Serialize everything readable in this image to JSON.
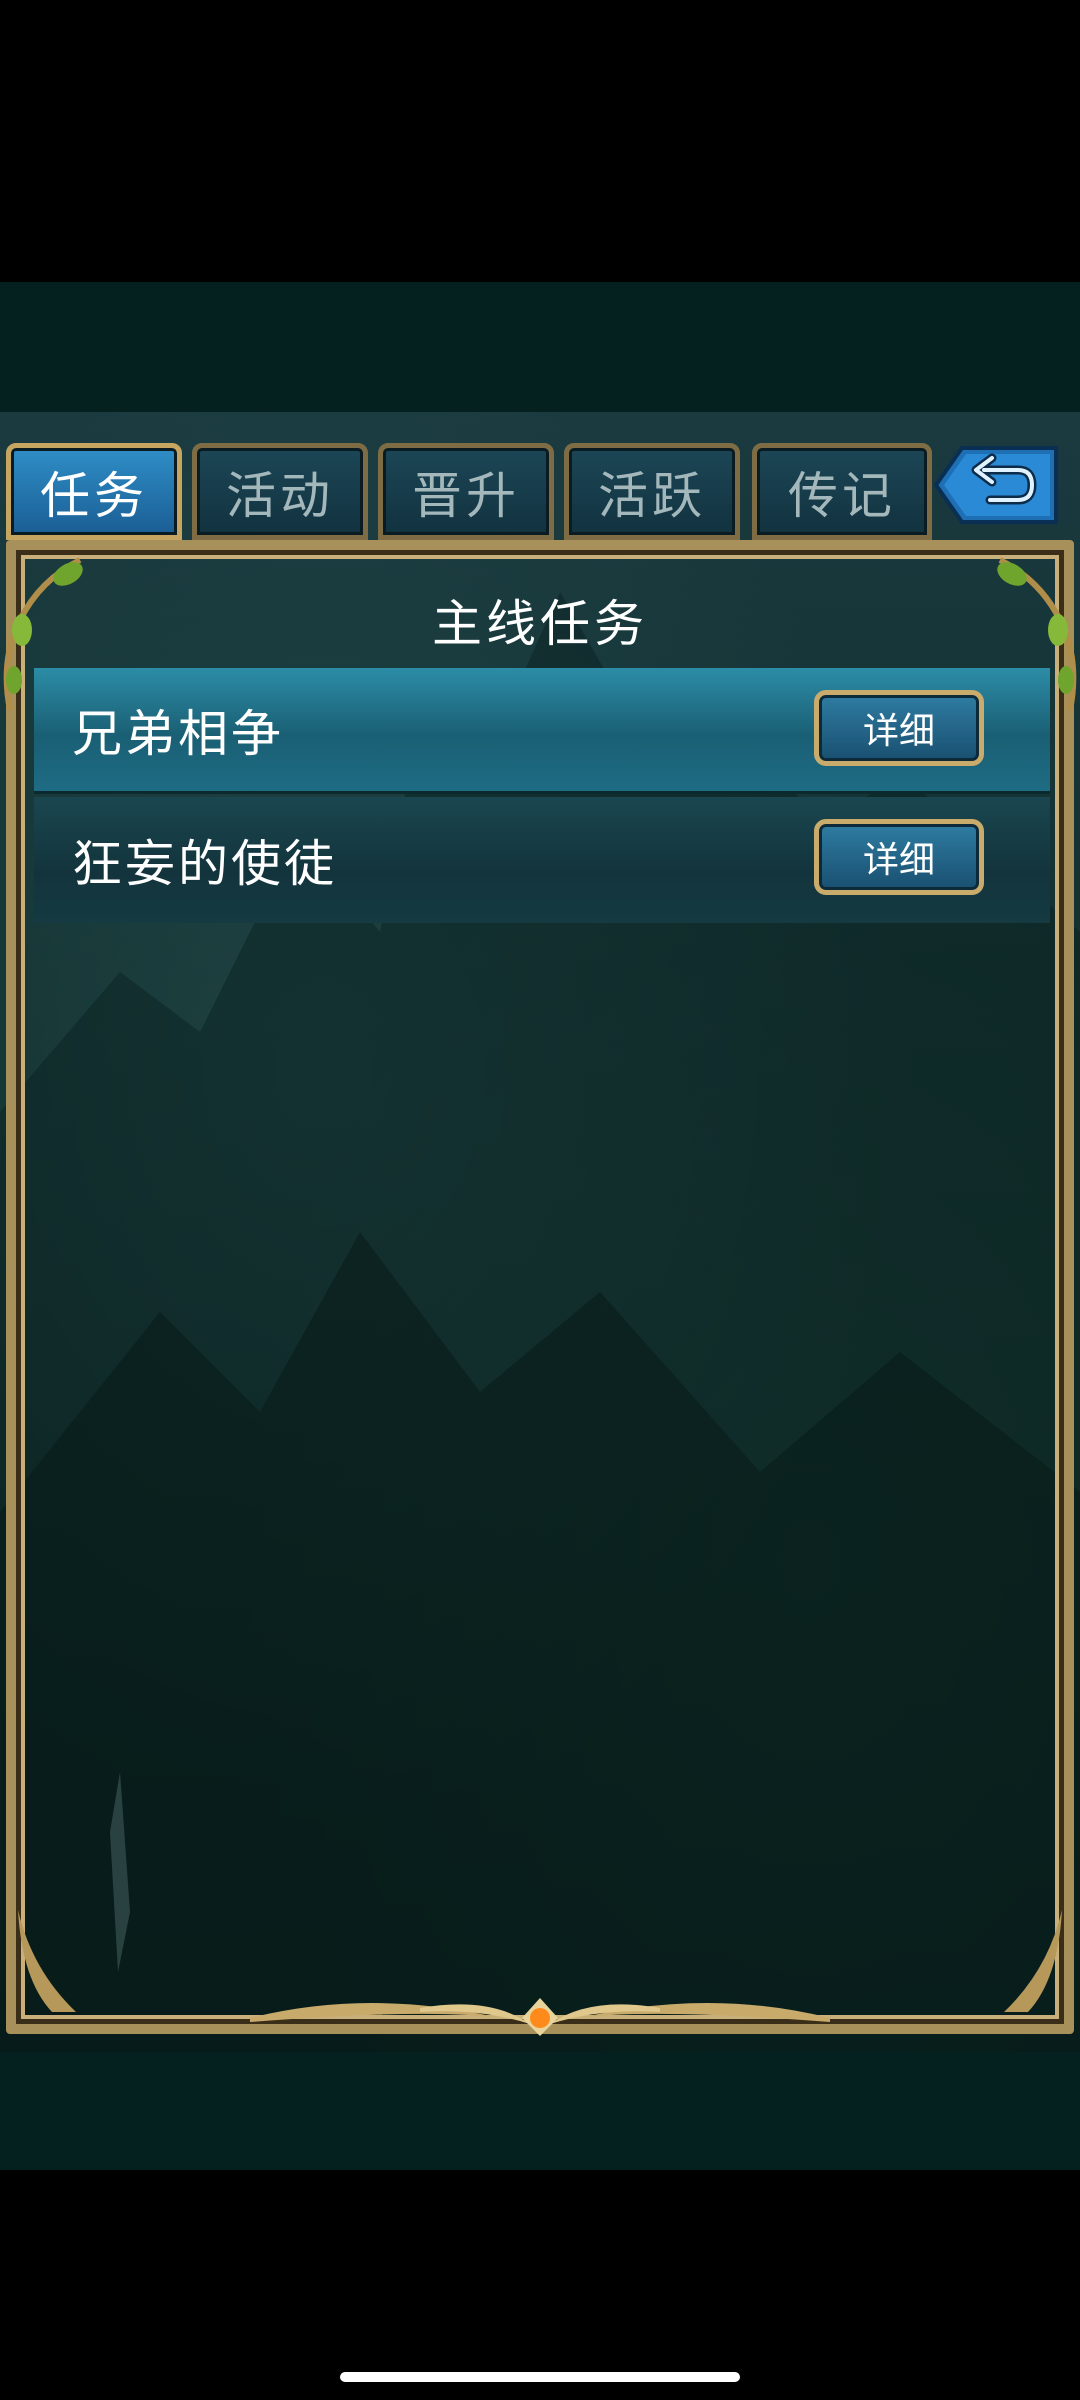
{
  "tabs": [
    {
      "label": "任务",
      "active": true
    },
    {
      "label": "活动",
      "active": false
    },
    {
      "label": "晋升",
      "active": false
    },
    {
      "label": "活跃",
      "active": false
    },
    {
      "label": "传记",
      "active": false
    }
  ],
  "back_icon": "back-arrow-icon",
  "panel": {
    "title": "主线任务",
    "quests": [
      {
        "name": "兄弟相争",
        "button": "详细",
        "selected": true
      },
      {
        "name": "狂妄的使徒",
        "button": "详细",
        "selected": false
      }
    ]
  },
  "colors": {
    "active_tab": "#2f8ec7",
    "frame_gold": "#a8905a",
    "selected_row": "#2c8ca6"
  }
}
